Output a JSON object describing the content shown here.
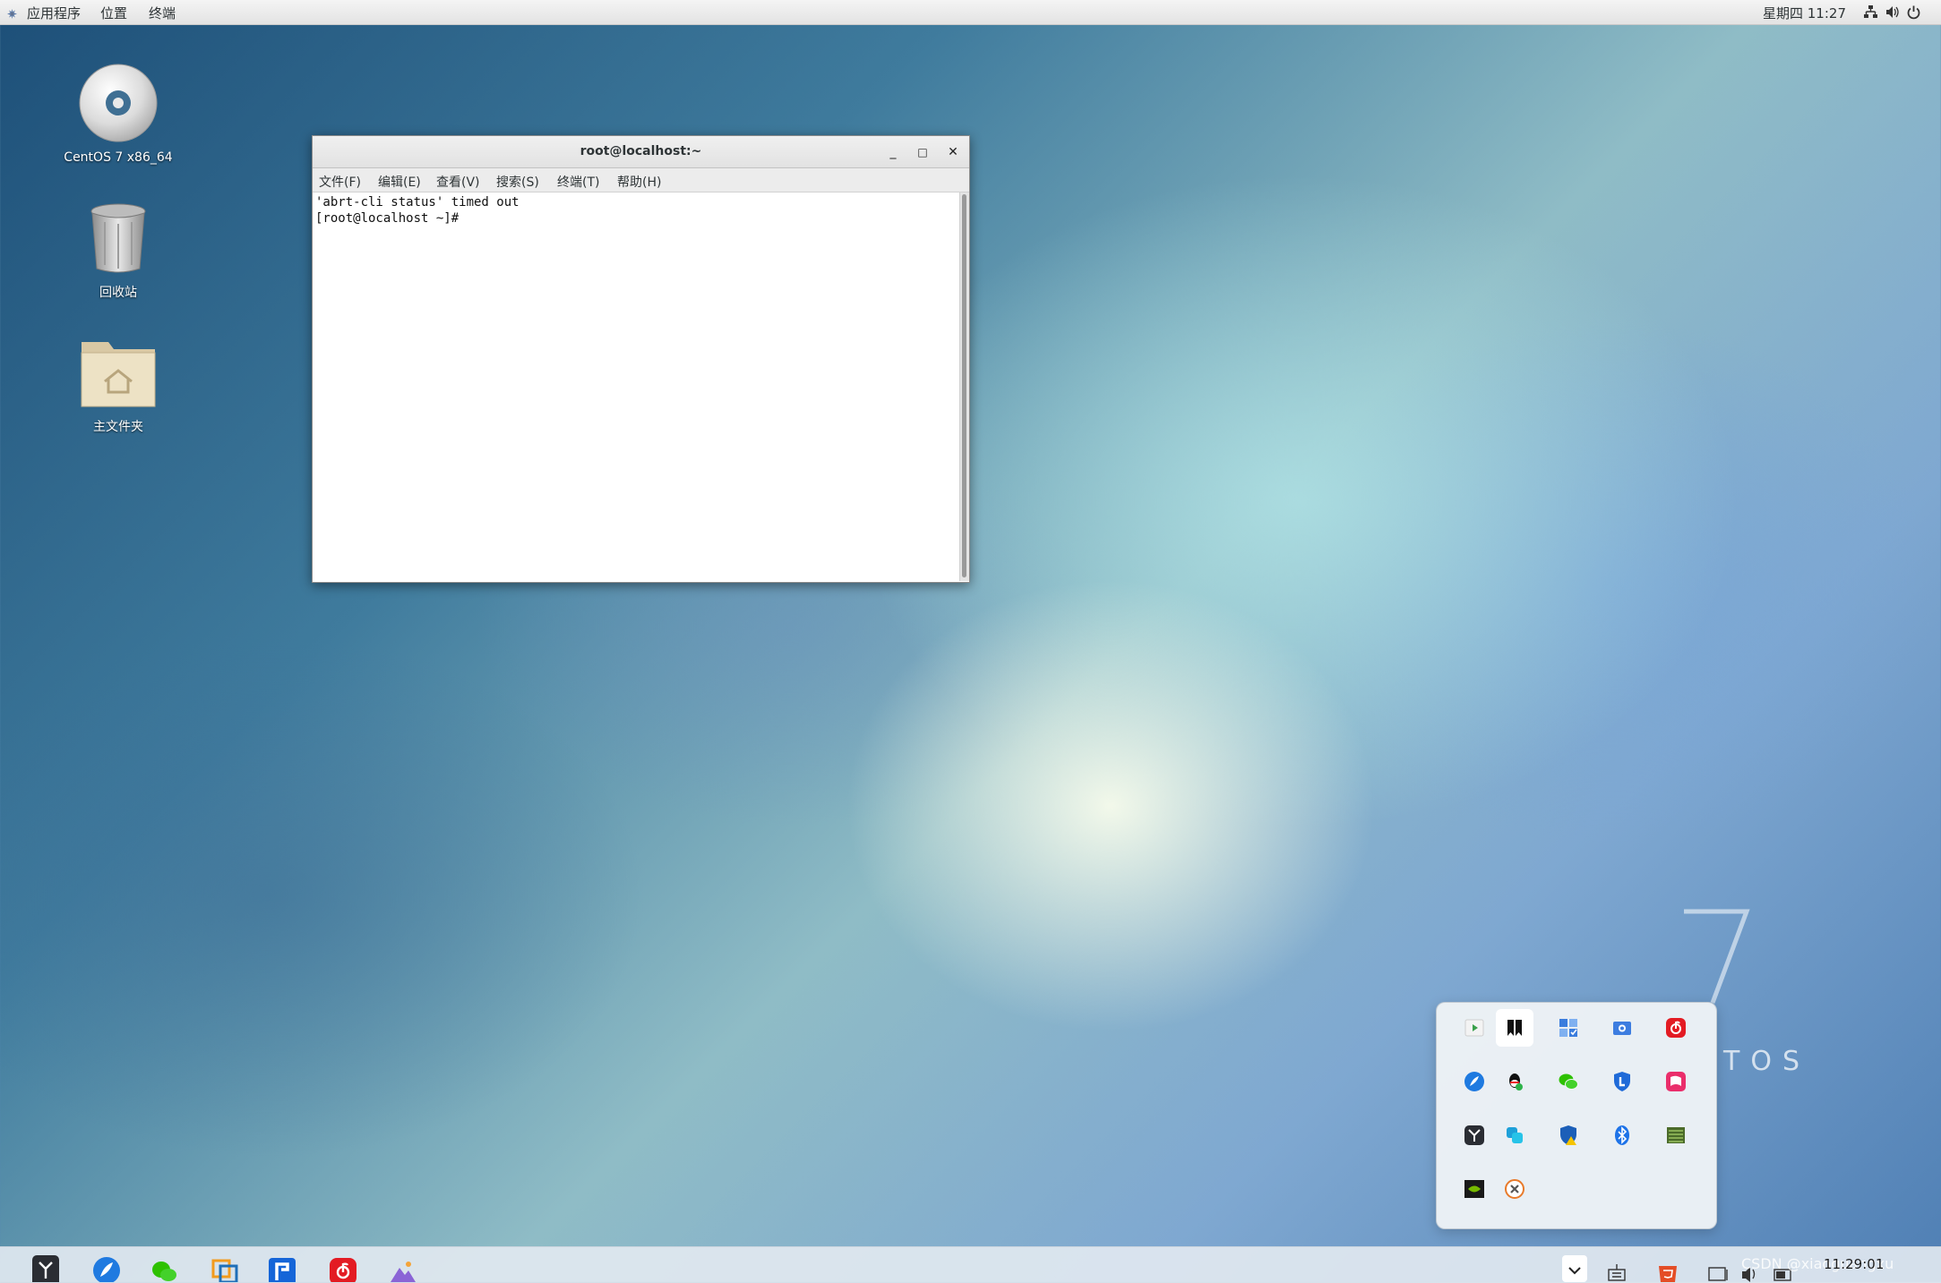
{
  "top_panel": {
    "menus": [
      "应用程序",
      "位置",
      "终端"
    ],
    "clock": "星期四 11:27",
    "tray_icons": [
      "network-icon",
      "volume-icon",
      "power-icon"
    ]
  },
  "desktop": {
    "icons": [
      {
        "label": "CentOS 7 x86_64",
        "icon": "cd-disc-icon"
      },
      {
        "label": "回收站",
        "icon": "trash-icon"
      },
      {
        "label": "主文件夹",
        "icon": "home-folder-icon"
      }
    ]
  },
  "terminal": {
    "title": "root@localhost:~",
    "controls": {
      "minimize": "_",
      "maximize": "□",
      "close": "✕"
    },
    "menu": [
      "文件(F)",
      "编辑(E)",
      "查看(V)",
      "搜索(S)",
      "终端(T)",
      "帮助(H)"
    ],
    "lines": [
      "'abrt-cli status' timed out",
      "[root@localhost ~]#"
    ]
  },
  "wallpaper": {
    "brand_text": "TOS"
  },
  "tray_popup": {
    "icons": [
      "media-player-icon",
      "bookmark-app-icon",
      "task-board-icon",
      "screenshot-icon",
      "netease-music-icon",
      "feishu-icon",
      "qq-icon",
      "wechat-icon",
      "security-shield-icon",
      "pink-app-icon",
      "dark-app-icon",
      "teams-app-icon",
      "defender-warning-icon",
      "bluetooth-icon",
      "gpu-monitor-icon",
      "nvidia-icon",
      "settings-x-icon"
    ]
  },
  "taskbar": {
    "apps": [
      "dark-app-icon",
      "feishu-icon",
      "wechat-icon",
      "vmware-icon",
      "blue-app-icon",
      "netease-music-icon",
      "photos-icon"
    ],
    "tray": [
      "chevron-up-icon",
      "input-method-icon",
      "html-app-icon",
      "display-icon",
      "speaker-icon",
      "battery-icon"
    ],
    "time": "11:29:01",
    "watermark": "CSDN @xiaoguangxu"
  },
  "colors": {
    "wallpaper_dark": "#1d4f78",
    "wallpaper_light": "#f8fcec",
    "panel": "#e9e9e9",
    "terminal_bg": "#ffffff"
  }
}
